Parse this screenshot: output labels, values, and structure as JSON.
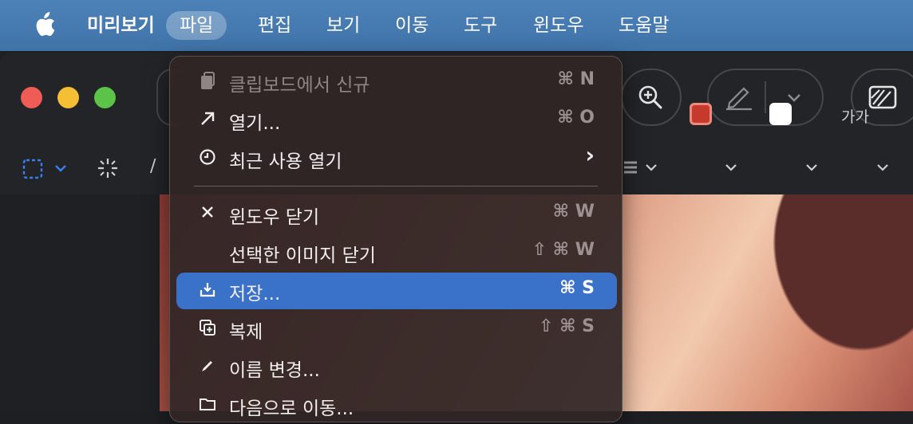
{
  "menubar": {
    "app_name": "미리보기",
    "items": [
      "파일",
      "편집",
      "보기",
      "이동",
      "도구",
      "윈도우",
      "도움말"
    ],
    "active_item": "파일"
  },
  "toolbar": {
    "font_size_label": "가가",
    "border_color": "#c53a2c",
    "fill_color": "#ffffff"
  },
  "file_menu": {
    "items": [
      {
        "label": "클립보드에서 신규",
        "shortcut": "⌘ N",
        "icon": "clipboard-icon",
        "enabled": false
      },
      {
        "label": "열기...",
        "shortcut": "⌘ O",
        "icon": "arrow-up-right-icon",
        "enabled": true
      },
      {
        "label": "최근 사용 열기",
        "shortcut": "›",
        "icon": "clock-icon",
        "enabled": true
      },
      {
        "label": "윈도우 닫기",
        "shortcut": "⌘ W",
        "icon": "close-icon",
        "enabled": true
      },
      {
        "label": "선택한 이미지 닫기",
        "shortcut": "⇧ ⌘ W",
        "icon": "",
        "enabled": true
      },
      {
        "label": "저장...",
        "shortcut": "⌘ S",
        "icon": "download-icon",
        "enabled": true,
        "highlighted": true
      },
      {
        "label": "복제",
        "shortcut": "⇧ ⌘ S",
        "icon": "duplicate-icon",
        "enabled": true
      },
      {
        "label": "이름 변경...",
        "shortcut": "",
        "icon": "pencil-icon",
        "enabled": true
      },
      {
        "label": "다음으로 이동...",
        "shortcut": "",
        "icon": "folder-icon",
        "enabled": true
      }
    ]
  }
}
